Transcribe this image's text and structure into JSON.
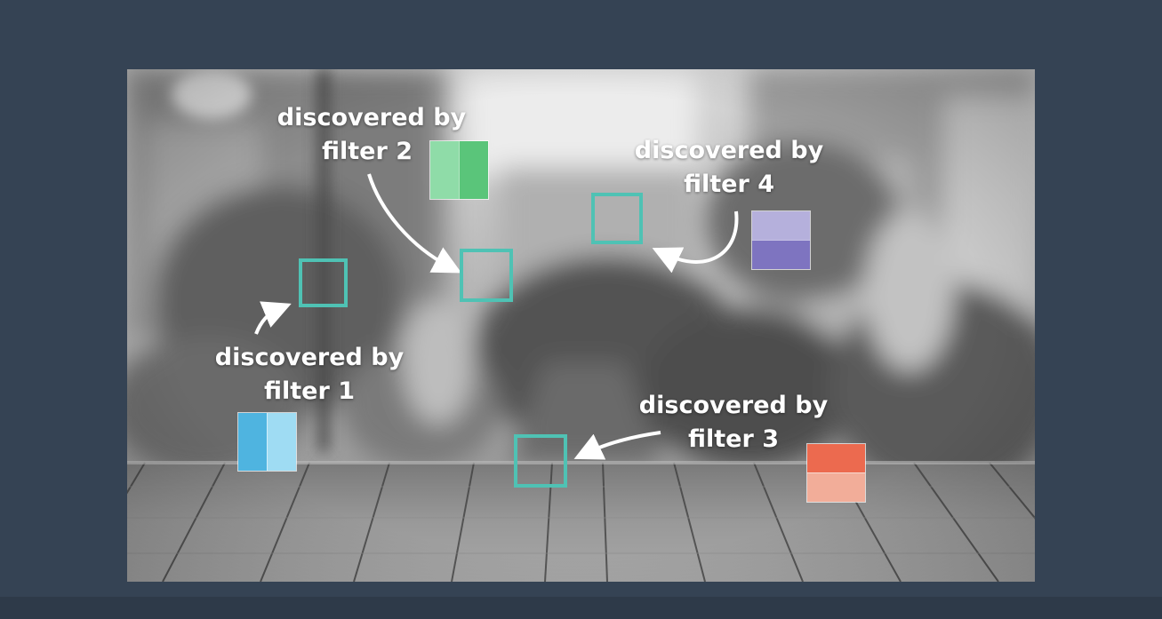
{
  "labels": {
    "filter1": {
      "line1": "discovered by",
      "line2": "filter 1"
    },
    "filter2": {
      "line1": "discovered by",
      "line2": "filter 2"
    },
    "filter3": {
      "line1": "discovered by",
      "line2": "filter 3"
    },
    "filter4": {
      "line1": "discovered by",
      "line2": "filter 4"
    }
  },
  "colors": {
    "slide_background": "#354354",
    "box_outline": "#4fc2b4",
    "filter1_swatch": [
      "#4fb4e0",
      "#9fdcf3"
    ],
    "filter2_swatch": [
      "#8fdca8",
      "#5ac57a"
    ],
    "filter3_swatch": [
      "#ec6a4f",
      "#f2ad99"
    ],
    "filter4_swatch": [
      "#b5b0dc",
      "#7e74c0"
    ]
  }
}
